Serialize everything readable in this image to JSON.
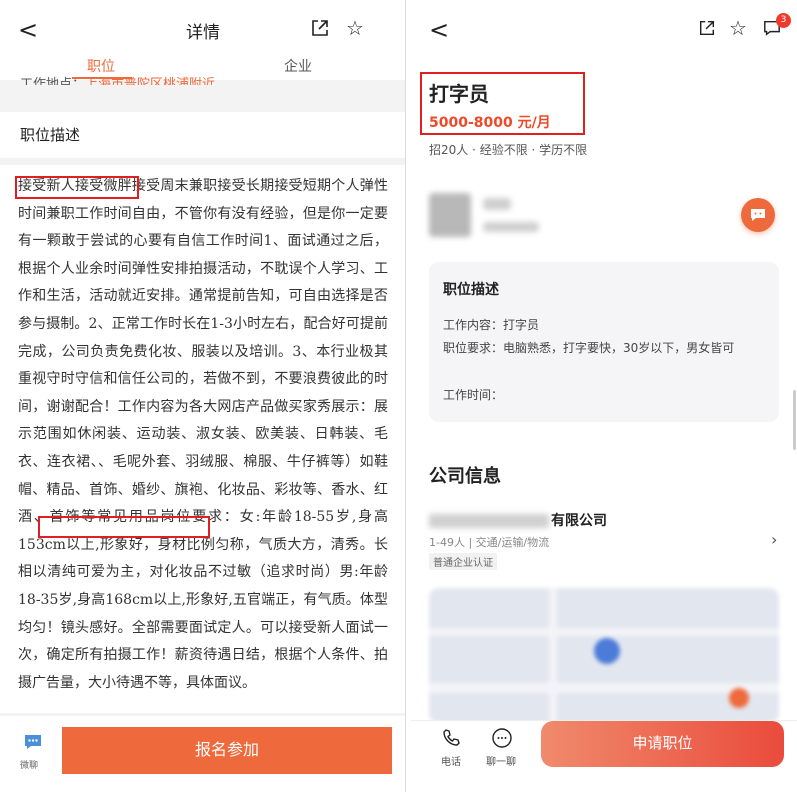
{
  "left": {
    "header": {
      "back": "<",
      "title": "详情",
      "star": "☆"
    },
    "tabs": [
      {
        "label": "职位"
      },
      {
        "label": "企业"
      }
    ],
    "cut_text": {
      "prefix": "工作地点：",
      "highlight": "上海市普陀区桃浦附近"
    },
    "section_title": "职位描述",
    "description": "接受新人接受微胖接受周末兼职接受长期接受短期个人弹性时间兼职工作时间自由，不管你有没有经验，但是你一定要有一颗敢于尝试的心要有自信工作时间1、面试通过之后，根据个人业余时间弹性安排拍摄活动，不耽误个人学习、工作和生活，活动就近安排。通常提前告知，可自由选择是否参与摄制。2、正常工作时长在1-3小时左右，配合好可提前完成，公司负责免费化妆、服装以及培训。3、本行业极其重视守时守信和信任公司的，若做不到，不要浪费彼此的时间，谢谢配合！工作内容为各大网店产品做买家秀展示：展示范围如休闲装、运动装、淑女装、欧美装、日韩装、毛衣、连衣裙、、毛呢外套、羽绒服、棉服、牛仔裤等）如鞋帽、精品、首饰、婚纱、旗袍、化妆品、彩妆等、香水、红酒、首饰等常见用品岗位要求：女:年龄18-55岁,身高153cm以上,形象好，身材比例匀称，气质大方，清秀。长相以清纯可爱为主，对化妆品不过敏（追求时尚）男:年龄18-35岁,身高168cm以上,形象好,五官端正，有气质。体型均匀！镜头感好。全部需要面试定人。可以接受新人面试一次，确定所有拍摄工作！薪资待遇日结，根据个人条件、拍摄广告量，大小待遇不等，具体面议。",
    "bottom": {
      "wechat_label": "微聊",
      "apply_label": "报名参加"
    }
  },
  "right": {
    "header": {
      "back": "<",
      "star": "☆",
      "badge": "3"
    },
    "job": {
      "title": "打字员",
      "salary": "5000-8000 元/月",
      "meta": "招20人 · 经验不限 · 学历不限"
    },
    "card": {
      "title": "职位描述",
      "content": "工作内容：打字员",
      "requirement": "职位要求：电脑熟悉，打字要快，30岁以下，男女皆可",
      "time": "工作时间："
    },
    "company": {
      "heading": "公司信息",
      "name_suffix": "有限公司",
      "sub": "1-49人 | 交通/运输/物流",
      "tag": "普通企业认证",
      "chevron": "›"
    },
    "bottom": {
      "phone_label": "电话",
      "chat_label": "聊一聊",
      "apply_label": "申请职位"
    }
  },
  "colors": {
    "accent": "#ee6a3c",
    "salary": "#ee4a2a",
    "highlight_box": "#e02020"
  }
}
